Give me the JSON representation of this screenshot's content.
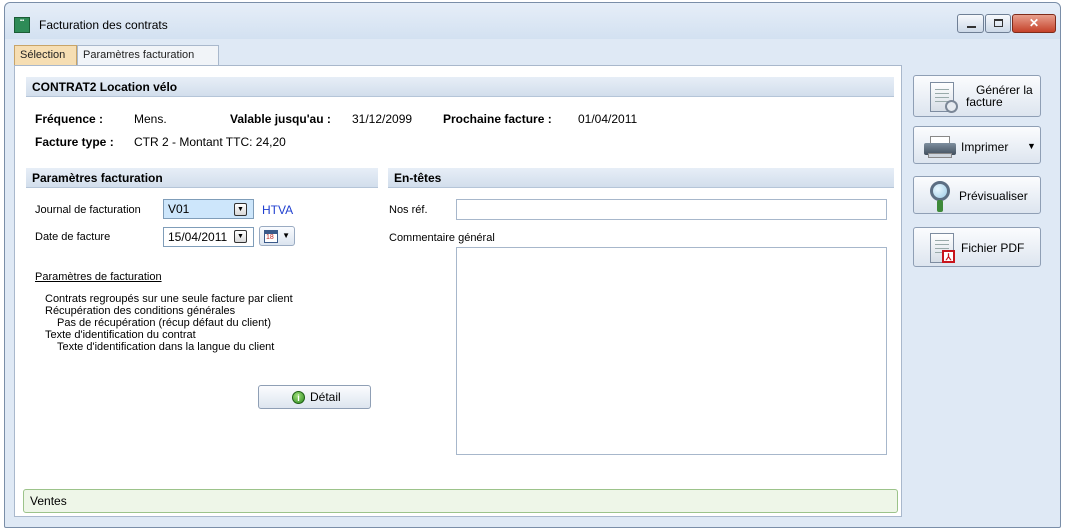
{
  "window": {
    "title": "Facturation des contrats",
    "controls": {
      "minimize": "minimize",
      "maximize": "maximize",
      "close": "close"
    }
  },
  "tabs": [
    {
      "label": "Sélection",
      "active": true
    },
    {
      "label": "Paramètres facturation",
      "active": false
    }
  ],
  "contract": {
    "header": "CONTRAT2  Location vélo",
    "frequence_label": "Fréquence :",
    "frequence_value": "Mens.",
    "valable_label": "Valable jusqu'au :",
    "valable_value": "31/12/2099",
    "prochaine_label": "Prochaine facture :",
    "prochaine_value": "01/04/2011",
    "facture_type_label": "Facture type :",
    "facture_type_value": "CTR 2 - Montant TTC: 24,20"
  },
  "params": {
    "header": "Paramètres facturation",
    "journal_label": "Journal de facturation",
    "journal_value": "V01",
    "journal_tag": "HTVA",
    "date_label": "Date de facture",
    "date_value": "15/04/2011",
    "link_title": "Paramètres de facturation",
    "lines": [
      "Contrats regroupés sur une seule facture par client",
      "Récupération des conditions générales",
      "Pas de récupération (récup défaut du client)",
      "Texte d'identification du contrat",
      "Texte d'identification dans la langue du client"
    ],
    "detail_button": "Détail"
  },
  "entetes": {
    "header": "En-têtes",
    "nos_ref_label": "Nos réf.",
    "nos_ref_value": "",
    "commentaire_label": "Commentaire général",
    "commentaire_value": ""
  },
  "footer": {
    "ventes_label": "Ventes"
  },
  "actions": {
    "generer_line1": "Générer la",
    "generer_line2": "facture",
    "imprimer": "Imprimer",
    "previsualiser": "Prévisualiser",
    "fichier_pdf": "Fichier PDF"
  },
  "colors": {
    "tab_active": "#f6deb3",
    "journal_highlight": "#cde6fb",
    "htva_link": "#1f3fd0",
    "ventes_bg": "#eef6e8"
  },
  "icons": [
    "app-icon",
    "calendar-icon",
    "info-icon",
    "invoice-gear-icon",
    "printer-icon",
    "magnifier-icon",
    "pdf-icon",
    "chevron-down-icon"
  ]
}
